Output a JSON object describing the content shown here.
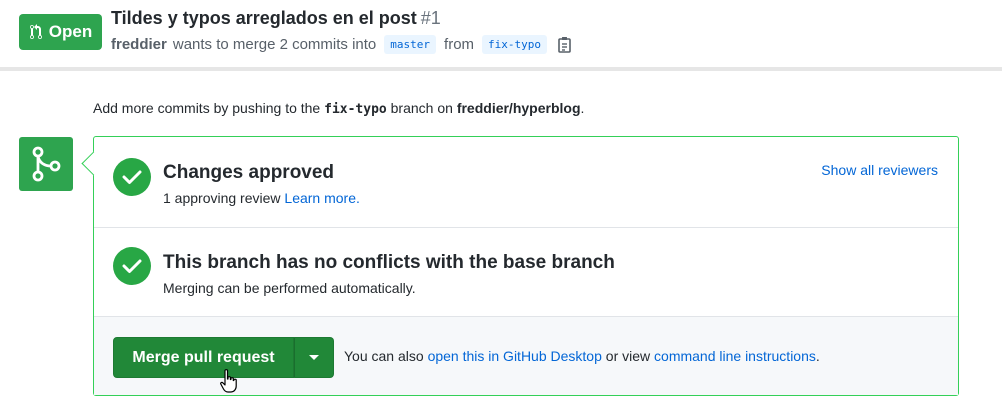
{
  "header": {
    "state_label": "Open",
    "title": "Tildes y typos arreglados en el post",
    "number": "#1",
    "author": "freddier",
    "meta_text": "wants to merge 2 commits into",
    "base_branch": "master",
    "from_text": "from",
    "head_branch": "fix-typo"
  },
  "push_hint": {
    "prefix": "Add more commits by pushing to the",
    "branch": "fix-typo",
    "middle": "branch on",
    "repo": "freddier/hyperblog",
    "suffix": "."
  },
  "approval": {
    "heading": "Changes approved",
    "sub_text": "1 approving review",
    "learn_more": "Learn more.",
    "show_reviewers": "Show all reviewers"
  },
  "conflicts": {
    "heading": "This branch has no conflicts with the base branch",
    "sub_text": "Merging can be performed automatically."
  },
  "merge": {
    "button_label": "Merge pull request",
    "alt_prefix": "You can also",
    "desktop_link": "open this in GitHub Desktop",
    "alt_middle": "or view",
    "cli_link": "command line instructions",
    "alt_suffix": "."
  },
  "colors": {
    "success": "#2ea44f",
    "merge_button": "#218838",
    "link": "#0366d6",
    "border_success": "#34d058"
  },
  "icons": [
    "git-pull-request-icon",
    "clipboard-icon",
    "git-merge-icon",
    "check-icon",
    "caret-down-icon",
    "hand-pointer-cursor-icon"
  ]
}
